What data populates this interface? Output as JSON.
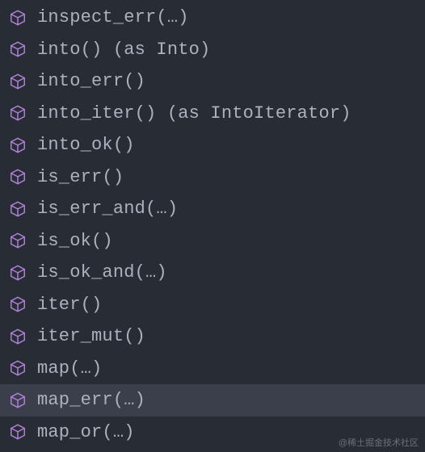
{
  "colors": {
    "background": "#282c34",
    "text": "#abb2bf",
    "selected_bg": "#3a3f4b",
    "icon": "#b180d7"
  },
  "completion": {
    "items": [
      {
        "label": "inspect_err(…)",
        "kind": "method",
        "selected": false
      },
      {
        "label": "into() (as Into)",
        "kind": "method",
        "selected": false
      },
      {
        "label": "into_err()",
        "kind": "method",
        "selected": false
      },
      {
        "label": "into_iter() (as IntoIterator)",
        "kind": "method",
        "selected": false
      },
      {
        "label": "into_ok()",
        "kind": "method",
        "selected": false
      },
      {
        "label": "is_err()",
        "kind": "method",
        "selected": false
      },
      {
        "label": "is_err_and(…)",
        "kind": "method",
        "selected": false
      },
      {
        "label": "is_ok()",
        "kind": "method",
        "selected": false
      },
      {
        "label": "is_ok_and(…)",
        "kind": "method",
        "selected": false
      },
      {
        "label": "iter()",
        "kind": "method",
        "selected": false
      },
      {
        "label": "iter_mut()",
        "kind": "method",
        "selected": false
      },
      {
        "label": "map(…)",
        "kind": "method",
        "selected": false
      },
      {
        "label": "map_err(…)",
        "kind": "method",
        "selected": true
      },
      {
        "label": "map_or(…)",
        "kind": "method",
        "selected": false
      }
    ]
  },
  "watermark": "@稀土掘金技术社区"
}
